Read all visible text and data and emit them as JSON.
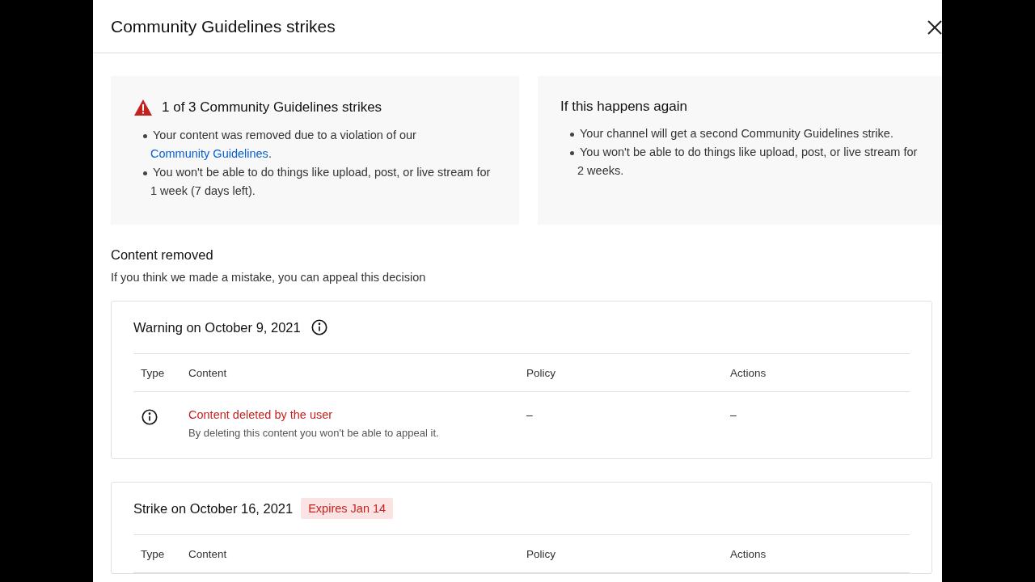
{
  "dialog": {
    "title": "Community Guidelines strikes"
  },
  "summary_cards": [
    {
      "kind": "alert",
      "title": "1 of 3 Community Guidelines strikes",
      "bullets": [
        {
          "text": "Your content was removed due to a violation of our ",
          "link": "Community Guidelines",
          "after": "."
        },
        {
          "text": "You won't be able to do things like upload, post, or live stream for 1 week (7 days left)."
        }
      ]
    },
    {
      "kind": "plain",
      "title": "If this happens again",
      "bullets": [
        {
          "text": "Your channel will get a second Community Guidelines strike."
        },
        {
          "text": "You won't be able to do things like upload, post, or live stream for 2 weeks."
        }
      ]
    }
  ],
  "content_removed": {
    "heading": "Content removed",
    "subtitle": "If you think we made a mistake, you can appeal this decision"
  },
  "sections": [
    {
      "kind": "warning",
      "title": "Warning on October 9, 2021",
      "columns": [
        "Type",
        "Content",
        "Policy",
        "Actions"
      ],
      "rows": [
        {
          "title": "Content deleted by the user",
          "subtitle": "By deleting this content you won't be able to appeal it.",
          "policy": "–",
          "actions": "–"
        }
      ]
    },
    {
      "kind": "strike",
      "title": "Strike on October 16, 2021",
      "badge": "Expires Jan 14",
      "columns": [
        "Type",
        "Content",
        "Policy",
        "Actions"
      ]
    }
  ]
}
